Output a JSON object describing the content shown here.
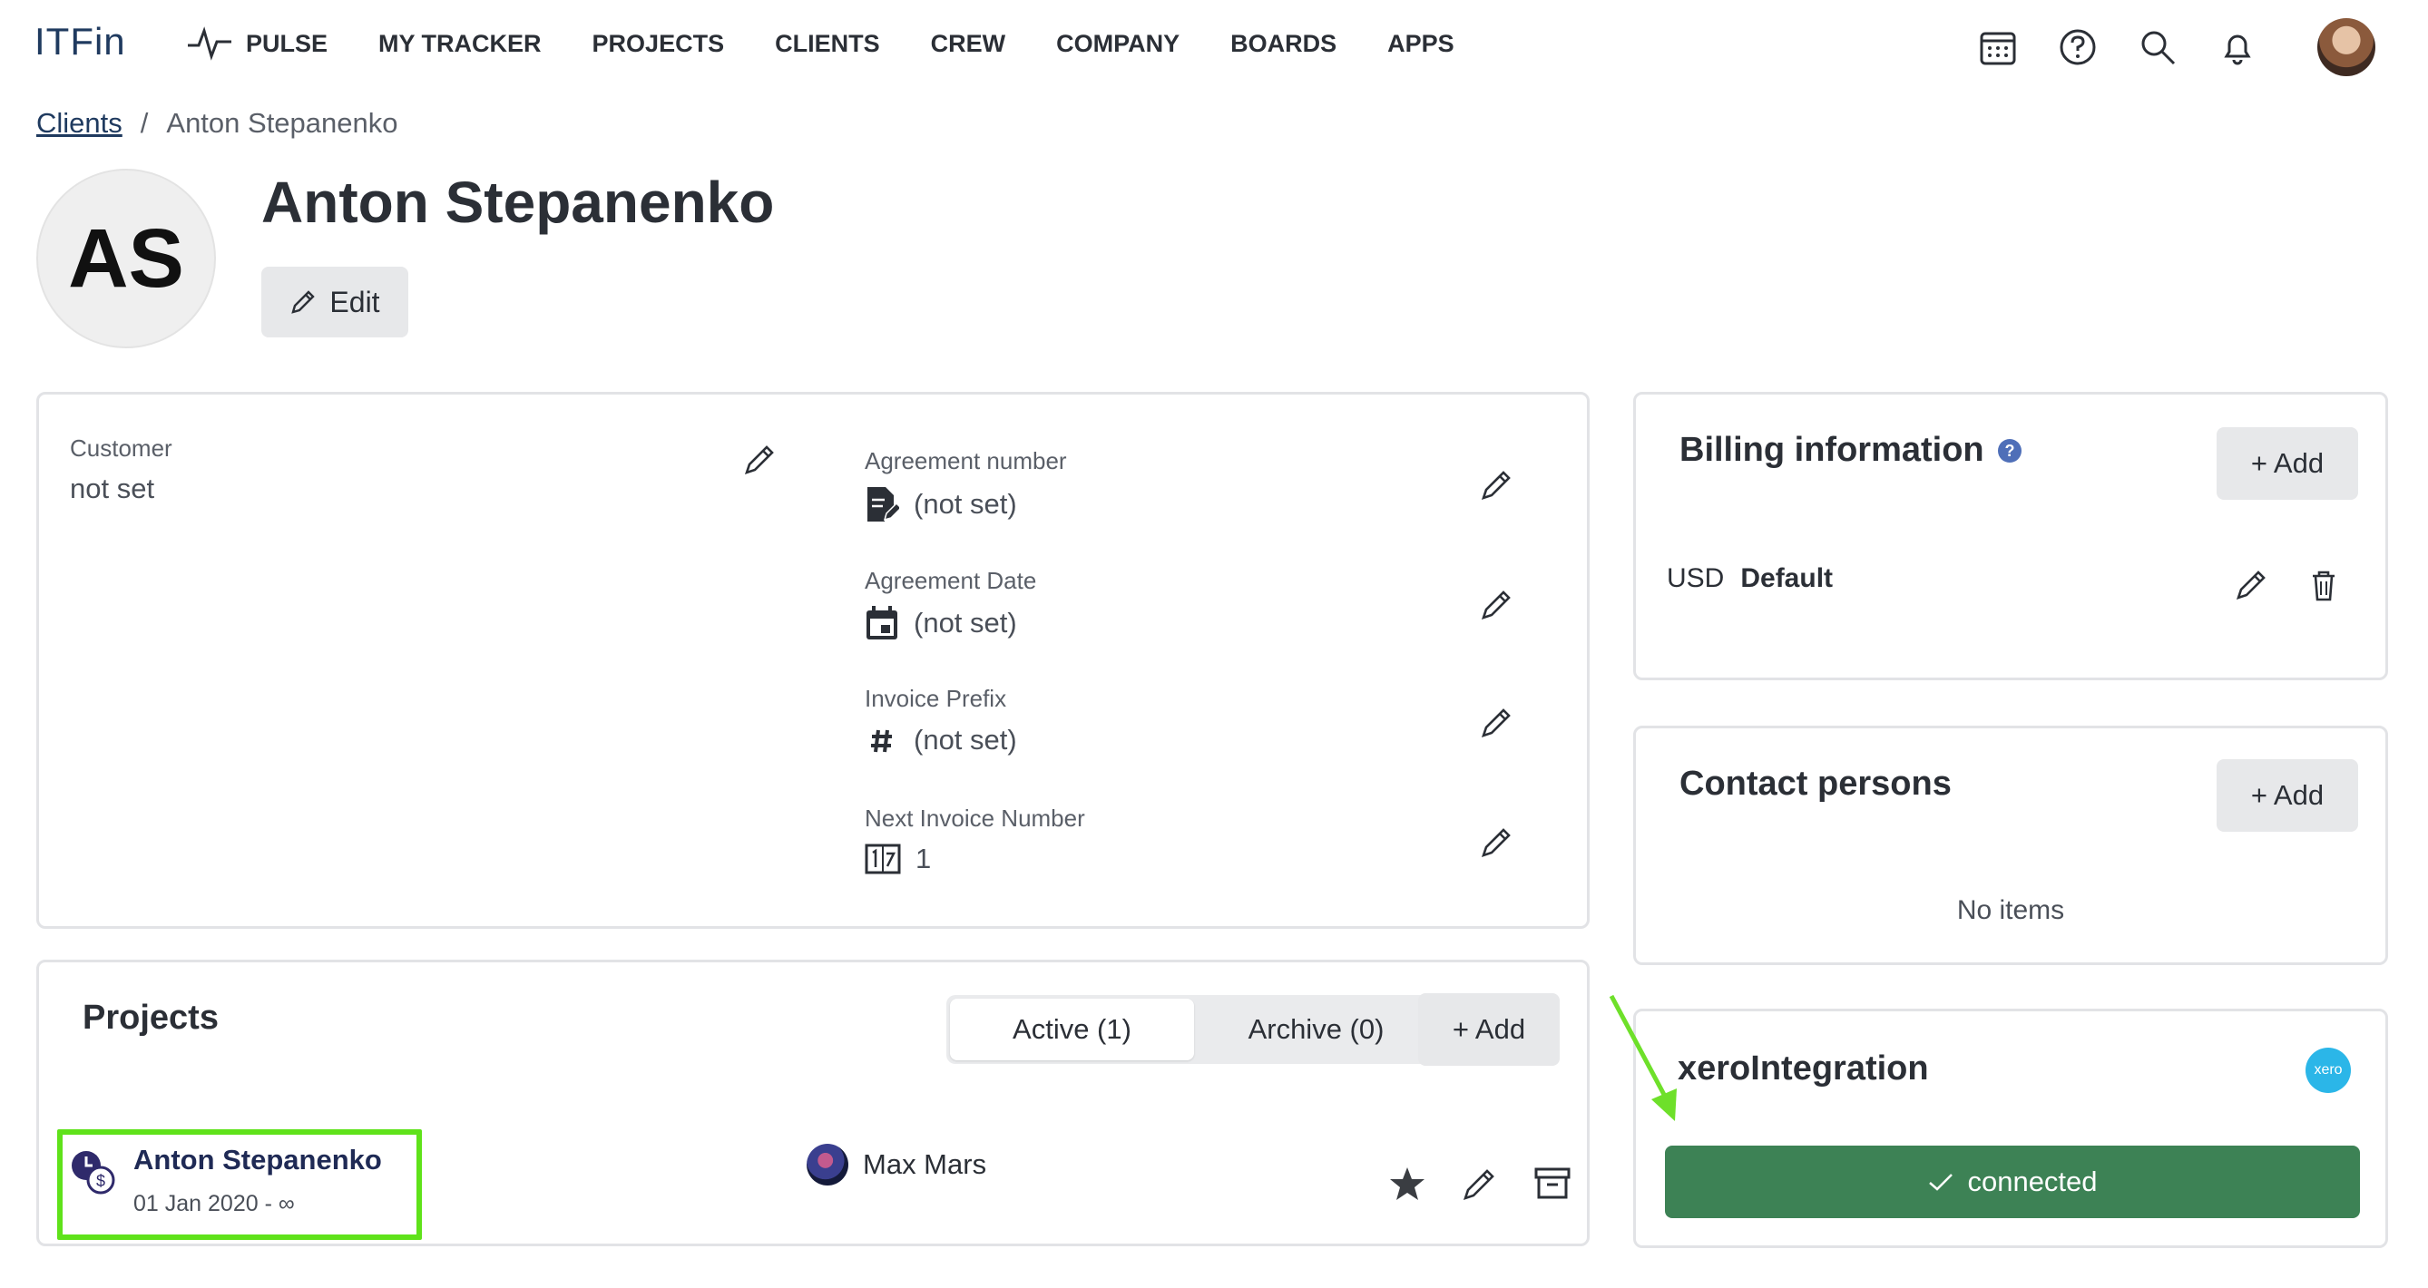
{
  "app": {
    "logo": "ITFin"
  },
  "nav": {
    "items": [
      {
        "label": "PULSE"
      },
      {
        "label": "MY TRACKER"
      },
      {
        "label": "PROJECTS"
      },
      {
        "label": "CLIENTS"
      },
      {
        "label": "CREW"
      },
      {
        "label": "COMPANY"
      },
      {
        "label": "BOARDS"
      },
      {
        "label": "APPS"
      }
    ]
  },
  "breadcrumb": {
    "parent": "Clients",
    "separator": "/",
    "current": "Anton Stepanenko"
  },
  "client": {
    "initials": "AS",
    "name": "Anton Stepanenko",
    "edit_label": "Edit"
  },
  "info": {
    "customer_label": "Customer",
    "customer_value": "not set",
    "agreement_number_label": "Agreement number",
    "agreement_number_value": "(not set)",
    "agreement_date_label": "Agreement Date",
    "agreement_date_value": "(not set)",
    "invoice_prefix_label": "Invoice Prefix",
    "invoice_prefix_value": "(not set)",
    "next_invoice_label": "Next Invoice Number",
    "next_invoice_value": "1"
  },
  "projects": {
    "title": "Projects",
    "tab_active": "Active (1)",
    "tab_archive": "Archive (0)",
    "add_label": "+ Add",
    "row": {
      "name": "Anton Stepanenko",
      "dates": "01 Jan 2020 - ∞",
      "manager": "Max Mars"
    }
  },
  "billing": {
    "title": "Billing information",
    "add_label": "+ Add",
    "currency": "USD",
    "name": "Default"
  },
  "contacts": {
    "title": "Contact persons",
    "add_label": "+ Add",
    "empty": "No items"
  },
  "xero": {
    "title": "xeroIntegration",
    "logo_text": "xero",
    "status": "connected"
  },
  "colors": {
    "accent_green": "#3d8255",
    "highlight": "#5fe21a",
    "brand_blue": "#1f3a5f"
  }
}
